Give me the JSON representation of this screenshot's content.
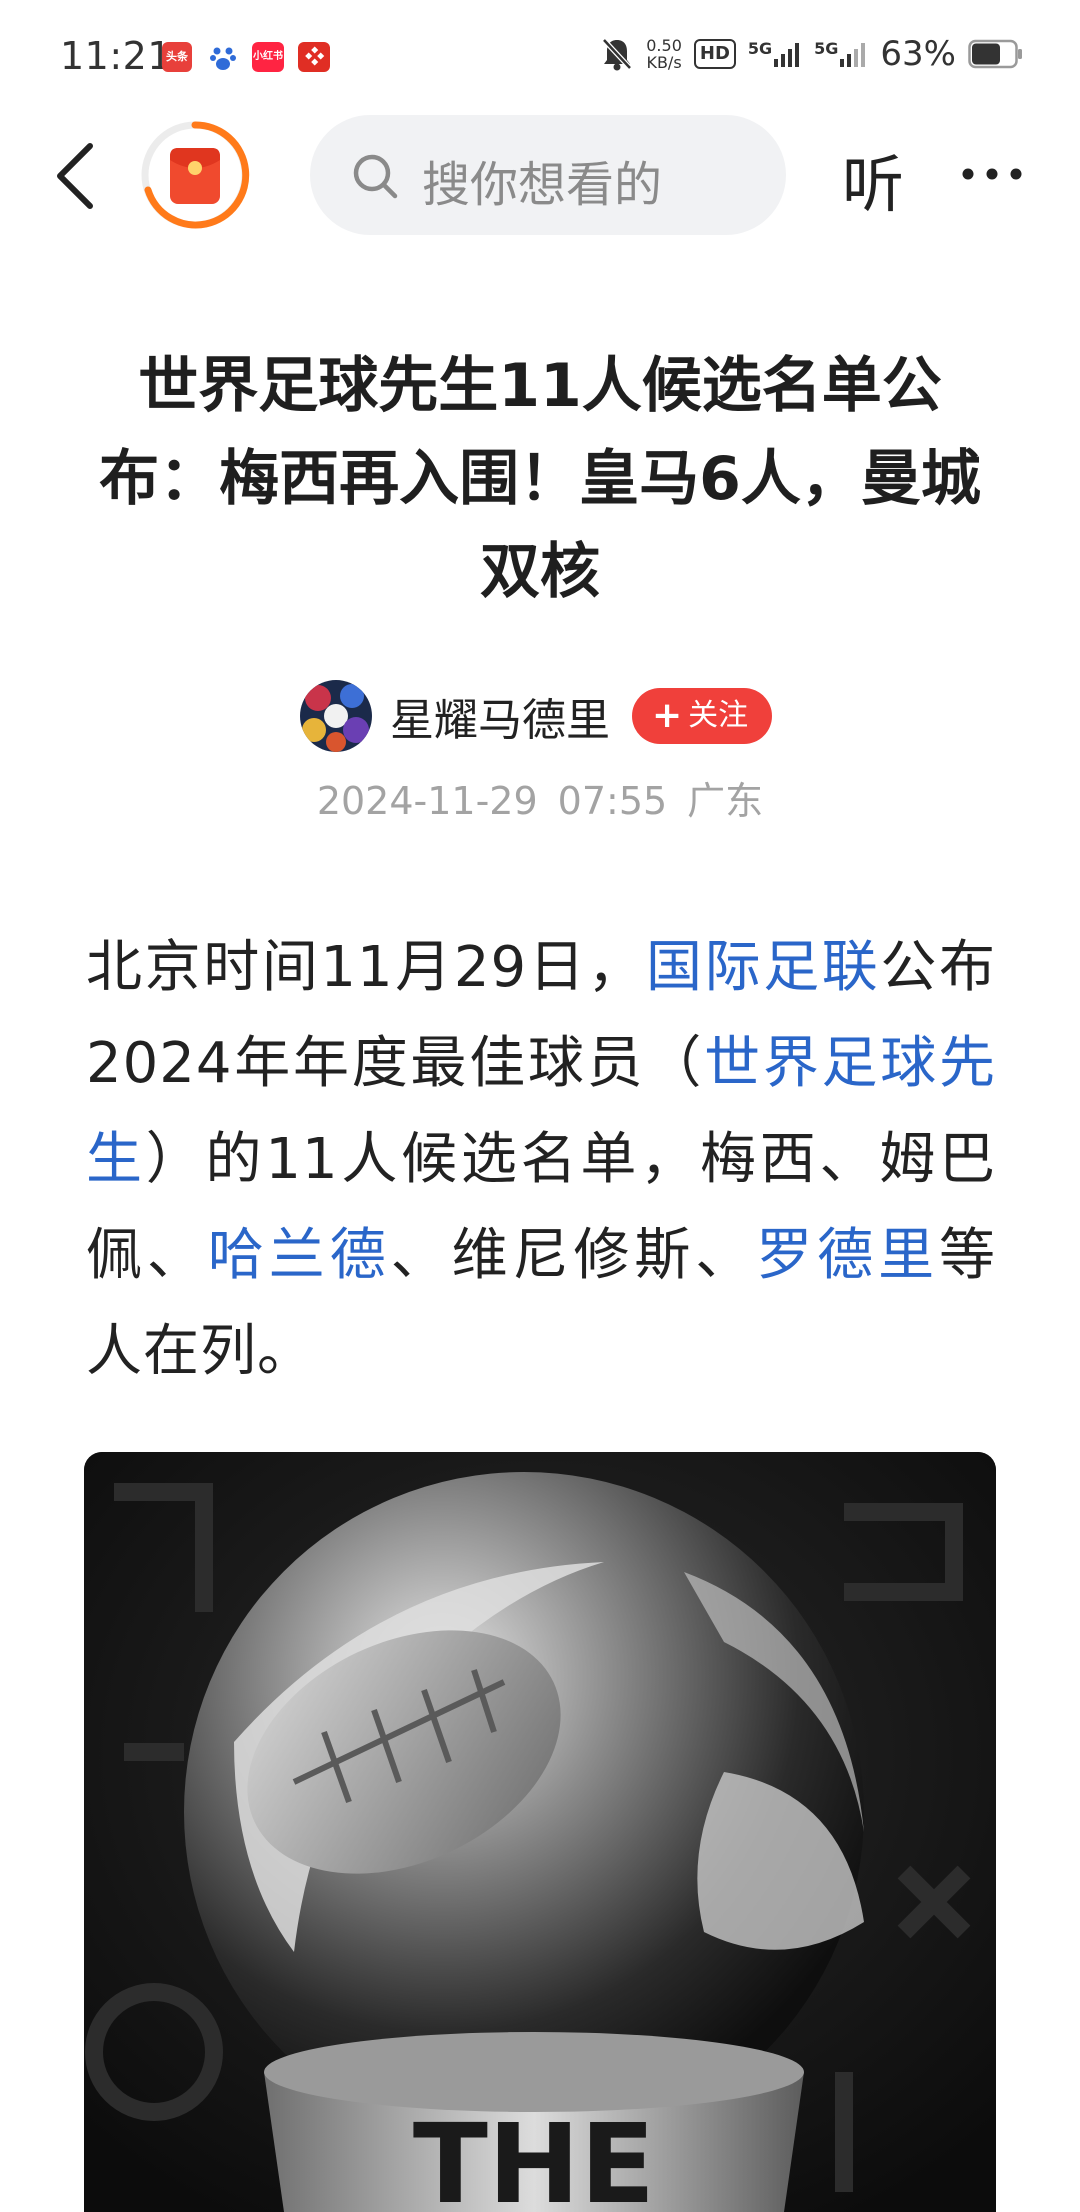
{
  "status_bar": {
    "time": "11:21",
    "apps": [
      "头条",
      "百度",
      "小红书",
      "拼多多"
    ],
    "net_speed_value": "0.50",
    "net_speed_unit": "KB/s",
    "hd": "HD",
    "signal1": "5G",
    "signal2": "5G",
    "battery": "63%"
  },
  "nav": {
    "search_placeholder": "搜你想看的",
    "listen_label": "听"
  },
  "article": {
    "title": "世界足球先生11人候选名单公布：梅西再入围！皇马6人，曼城双核",
    "author": "星耀马德里",
    "follow_label": "关注",
    "date": "2024-11-29",
    "time": "07:55",
    "location": "广东",
    "body": {
      "p1": "北京时间11月29日，",
      "k1": "国际足联",
      "p2": "公布2024年年度最佳球员（",
      "k2": "世界足球先生",
      "p3": "）的11人候选名单，梅西、姆巴佩、",
      "k3": "哈兰德",
      "p4": "、维尼修斯、",
      "k4": "罗德里",
      "p5": "等人在列。"
    },
    "image_text": "THE"
  },
  "colors": {
    "link": "#2a66c9",
    "follow": "#f0403b",
    "accent_orange": "#ff7a1a"
  }
}
